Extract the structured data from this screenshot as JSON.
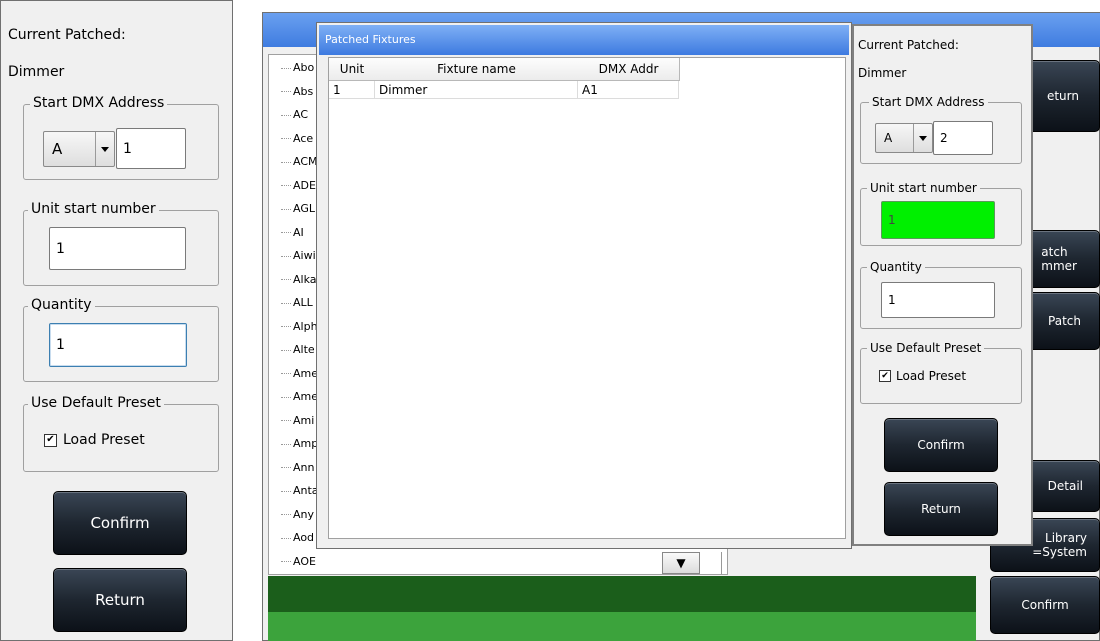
{
  "left_panel": {
    "current_patched_label": "Current Patched:",
    "fixture_name": "Dimmer",
    "start_dmx_legend": "Start DMX Address",
    "universe_value": "A",
    "address_value": "1",
    "unit_start_legend": "Unit start number",
    "unit_start_value": "1",
    "quantity_legend": "Quantity",
    "quantity_value": "1",
    "default_preset_legend": "Use Default Preset",
    "load_preset_label": "Load Preset",
    "load_preset_checked": true,
    "confirm_label": "Confirm",
    "return_label": "Return"
  },
  "fixture_list": {
    "items": [
      "Abo",
      "Abs",
      "AC",
      "Ace",
      "ACM",
      "ADE",
      "AGL",
      "AI",
      "Aiwi",
      "Alka",
      "ALL",
      "Alph",
      "Alte",
      "Ame",
      "Ame",
      "Ami",
      "Amp",
      "Ann",
      "Anta",
      "Any",
      "Aod",
      "AOE"
    ]
  },
  "background_buttons": {
    "return_label": "eturn",
    "patch_dimmer_label": "atch\nmmer",
    "patch_label": "Patch",
    "detail_label": "Detail",
    "library_label": "Library\n=System",
    "confirm_label": "Confirm"
  },
  "patched_dialog": {
    "title": "Patched Fixtures",
    "columns": [
      "Unit",
      "Fixture name",
      "DMX Addr"
    ],
    "rows": [
      {
        "unit": "1",
        "fixture_name": "Dimmer",
        "dmx_addr": "A1"
      }
    ]
  },
  "right_panel": {
    "current_patched_label": "Current Patched:",
    "fixture_name": "Dimmer",
    "start_dmx_legend": "Start DMX Address",
    "universe_value": "A",
    "address_value": "2",
    "unit_start_legend": "Unit start number",
    "unit_start_value": "1",
    "quantity_legend": "Quantity",
    "quantity_value": "1",
    "default_preset_legend": "Use Default Preset",
    "load_preset_label": "Load Preset",
    "load_preset_checked": true,
    "confirm_label": "Confirm",
    "return_label": "Return"
  },
  "colors": {
    "title_bar_blue": "#4a86e8",
    "unit_start_highlight": "#00f000",
    "bottom_green_dark": "#1b5e1b",
    "bottom_green_light": "#3ca33c"
  }
}
